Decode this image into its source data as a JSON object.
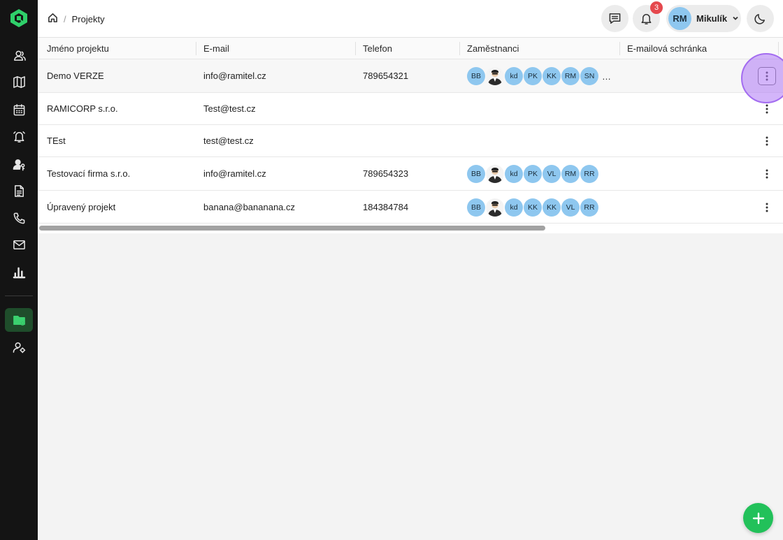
{
  "sidebar": {
    "items": [
      {
        "icon": "users-icon"
      },
      {
        "icon": "map-icon"
      },
      {
        "icon": "calendar-icon"
      },
      {
        "icon": "alarm-bell-icon"
      },
      {
        "icon": "user-key-icon"
      },
      {
        "icon": "document-icon"
      },
      {
        "icon": "phone-icon"
      },
      {
        "icon": "mail-icon"
      },
      {
        "icon": "bar-chart-icon"
      },
      {
        "icon": "folder-settings-icon",
        "active": true
      },
      {
        "icon": "user-settings-icon"
      }
    ],
    "active_color": "#3bd16f"
  },
  "header": {
    "breadcrumb": {
      "separator": "/",
      "current": "Projekty"
    },
    "notifications_count": "3",
    "user": {
      "initials": "RM",
      "name": "Mikulík"
    }
  },
  "table": {
    "columns": [
      "Jméno projektu",
      "E-mail",
      "Telefon",
      "Zaměstnanci",
      "E-mailová schránka"
    ],
    "rows": [
      {
        "name": "Demo VERZE",
        "email": "info@ramitel.cz",
        "phone": "789654321",
        "employees": [
          "BB",
          "photo",
          "kd",
          "PK",
          "KK",
          "RM",
          "SN"
        ],
        "more": "…"
      },
      {
        "name": "RAMICORP s.r.o.",
        "email": "Test@test.cz",
        "phone": "",
        "employees": [],
        "more": ""
      },
      {
        "name": "TEst",
        "email": "test@test.cz",
        "phone": "",
        "employees": [],
        "more": ""
      },
      {
        "name": "Testovací firma s.r.o.",
        "email": "info@ramitel.cz",
        "phone": "789654323",
        "employees": [
          "BB",
          "photo",
          "kd",
          "PK",
          "VL",
          "RM",
          "RR"
        ],
        "more": ""
      },
      {
        "name": "Úpravený projekt",
        "email": "banana@bananana.cz",
        "phone": "184384784",
        "employees": [
          "BB",
          "photo",
          "kd",
          "KK",
          "KK",
          "VL",
          "RR"
        ],
        "more": ""
      }
    ]
  },
  "colors": {
    "accent": "#22c15a",
    "avatar": "#8ec7ef",
    "badge": "#e5484d",
    "focus": "#a36cf0"
  }
}
